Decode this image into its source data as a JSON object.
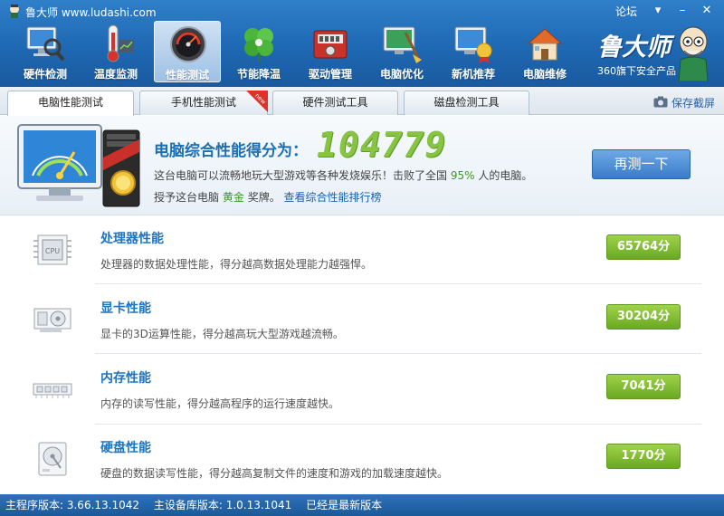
{
  "window": {
    "app_title": "鲁大师 www.ludashi.com",
    "forum_link": "论坛",
    "minimize": "–",
    "close": "✕",
    "menu": "▾"
  },
  "nav": [
    {
      "label": "硬件检测",
      "icon": "magnifier-monitor-icon"
    },
    {
      "label": "温度监测",
      "icon": "thermometer-icon"
    },
    {
      "label": "性能测试",
      "icon": "speedometer-icon",
      "active": true
    },
    {
      "label": "节能降温",
      "icon": "clover-icon"
    },
    {
      "label": "驱动管理",
      "icon": "driver-toolbox-icon"
    },
    {
      "label": "电脑优化",
      "icon": "monitor-broom-icon"
    },
    {
      "label": "新机推荐",
      "icon": "monitor-medal-icon"
    },
    {
      "label": "电脑维修",
      "icon": "house-icon"
    }
  ],
  "brand": {
    "name": "鲁大师",
    "sub": "360旗下安全产品"
  },
  "tabs": [
    {
      "label": "电脑性能测试",
      "active": true
    },
    {
      "label": "手机性能测试",
      "badge": "new"
    },
    {
      "label": "硬件测试工具"
    },
    {
      "label": "磁盘检测工具"
    }
  ],
  "save_screenshot": "保存截屏",
  "score": {
    "label": "电脑综合性能得分为：",
    "value": "104779",
    "desc_prefix": "这台电脑可以流畅地玩大型游戏等各种发烧娱乐！击败了全国",
    "percent": "95%",
    "desc_suffix": "人的电脑。",
    "award_prefix": "授予这台电脑",
    "award_level": "黄金",
    "award_suffix": "奖牌。",
    "ranking_link": "查看综合性能排行榜",
    "retest_button": "再测一下"
  },
  "metrics": [
    {
      "title": "处理器性能",
      "desc": "处理器的数据处理性能，得分越高数据处理能力越强悍。",
      "score": "65764分",
      "icon": "cpu-icon"
    },
    {
      "title": "显卡性能",
      "desc": "显卡的3D运算性能，得分越高玩大型游戏越流畅。",
      "score": "30204分",
      "icon": "graphics-card-icon"
    },
    {
      "title": "内存性能",
      "desc": "内存的读写性能，得分越高程序的运行速度越快。",
      "score": "7041分",
      "icon": "memory-icon"
    },
    {
      "title": "硬盘性能",
      "desc": "硬盘的数据读写性能，得分越高复制文件的速度和游戏的加载速度越快。",
      "score": "1770分",
      "icon": "hard-disk-icon"
    }
  ],
  "status": {
    "program_version": "主程序版本: 3.66.13.1042",
    "db_version": "主设备库版本: 1.0.13.1041",
    "update_state": "已经是最新版本"
  },
  "colors": {
    "header_blue": "#1f68b3",
    "score_green": "#86c442",
    "metric_title_blue": "#1d74c0",
    "badge_green": "#6aa922"
  }
}
